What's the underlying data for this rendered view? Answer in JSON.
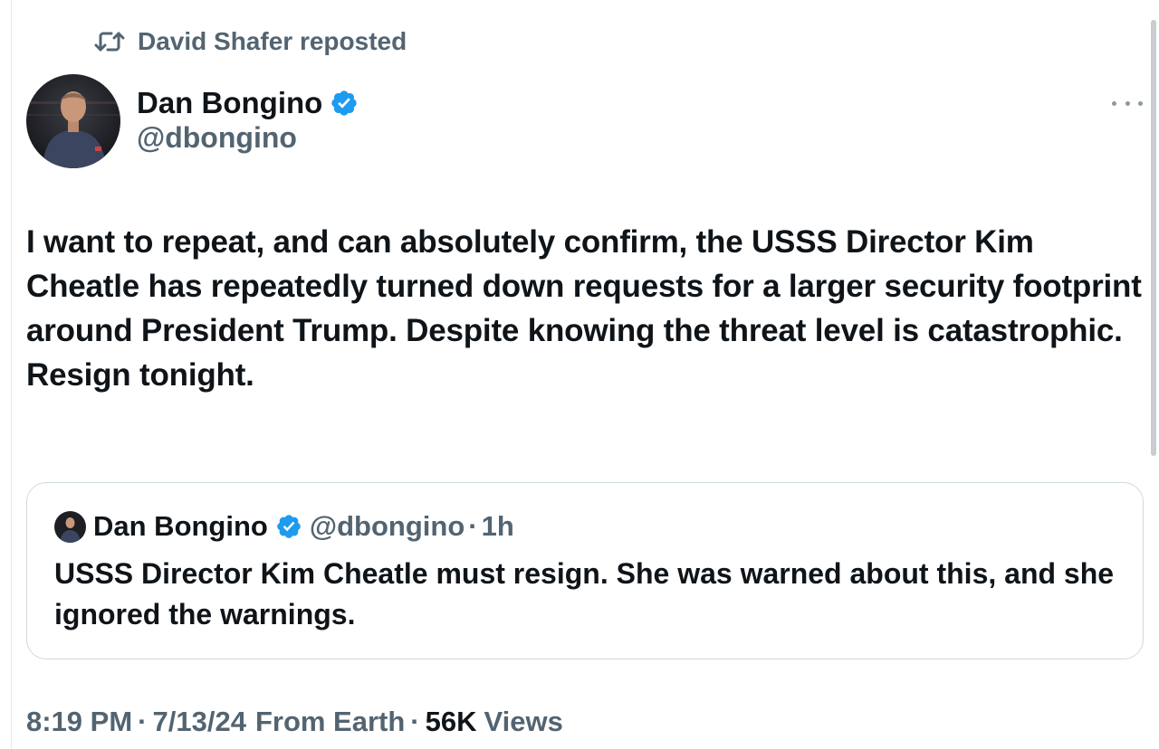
{
  "repost": {
    "icon": "retweet-icon",
    "text": "David Shafer reposted"
  },
  "author": {
    "name": "Dan Bongino",
    "handle": "@dbongino",
    "verified": true,
    "verified_color": "#1d9bf0"
  },
  "tweet": {
    "text": "I want to repeat, and can absolutely confirm, the USSS Director Kim Cheatle has repeatedly turned down requests for a larger security footprint around President Trump. Despite knowing the threat level is catastrophic.\nResign tonight."
  },
  "quoted_tweet": {
    "name": "Dan Bongino",
    "handle": "@dbongino",
    "separator": "·",
    "time": "1h",
    "text": "USSS Director Kim Cheatle must resign. She was warned about this, and she ignored the warnings."
  },
  "meta": {
    "time": "8:19 PM",
    "sep1": "·",
    "date": "7/13/24",
    "source": "From Earth",
    "sep2": "·",
    "views_count": "56K",
    "views_label": "Views"
  },
  "colors": {
    "text_primary": "#0f1419",
    "text_secondary": "#536471",
    "border": "#cfd9de",
    "accent": "#1d9bf0"
  }
}
